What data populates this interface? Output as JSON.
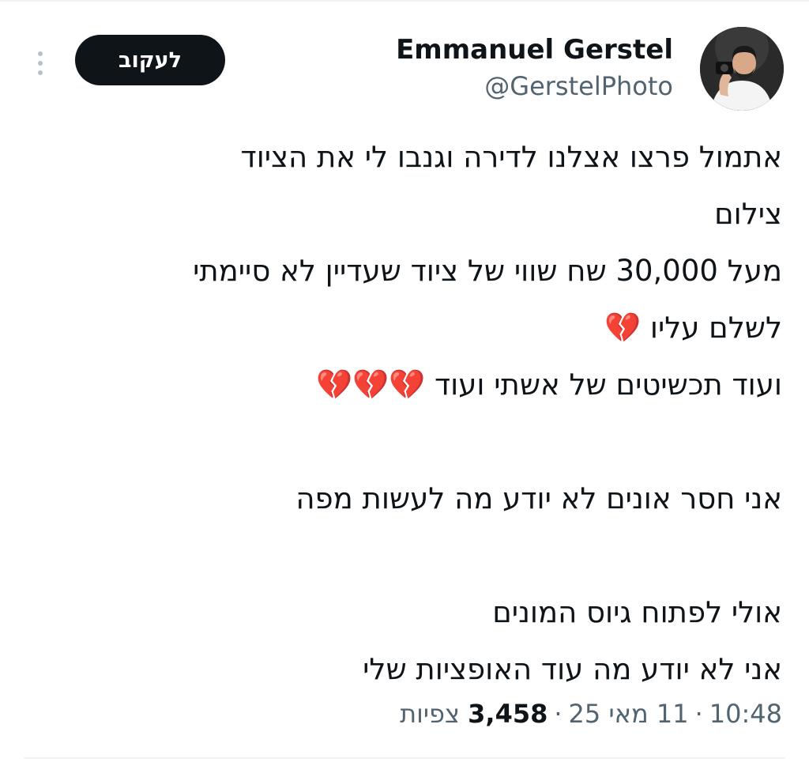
{
  "follow_button": {
    "label": "לעקוב"
  },
  "author": {
    "display_name": "Emmanuel Gerstel",
    "handle": "@GerstelPhoto"
  },
  "icons": {
    "more": "more-vertical-icon",
    "heart": "broken-heart-icon"
  },
  "tweet": {
    "lines": [
      "אתמול פרצו אצלנו לדירה וגנבו לי את הציוד",
      "צילום",
      "מעל 30,000 שח שווי של ציוד שעדיין לא סיימתי",
      "לשלם עליו 💔",
      "ועוד תכשיטים של אשתי ועוד 💔💔💔",
      "",
      "אני חסר אונים לא יודע מה לעשות מפה",
      "",
      "אולי לפתוח גיוס המונים",
      "אני לא יודע מה עוד האופציות שלי"
    ]
  },
  "meta": {
    "time": "10:48",
    "date": "11 מאי 25",
    "separator": "·",
    "views_count": "3,458",
    "views_label": "צפיות"
  }
}
